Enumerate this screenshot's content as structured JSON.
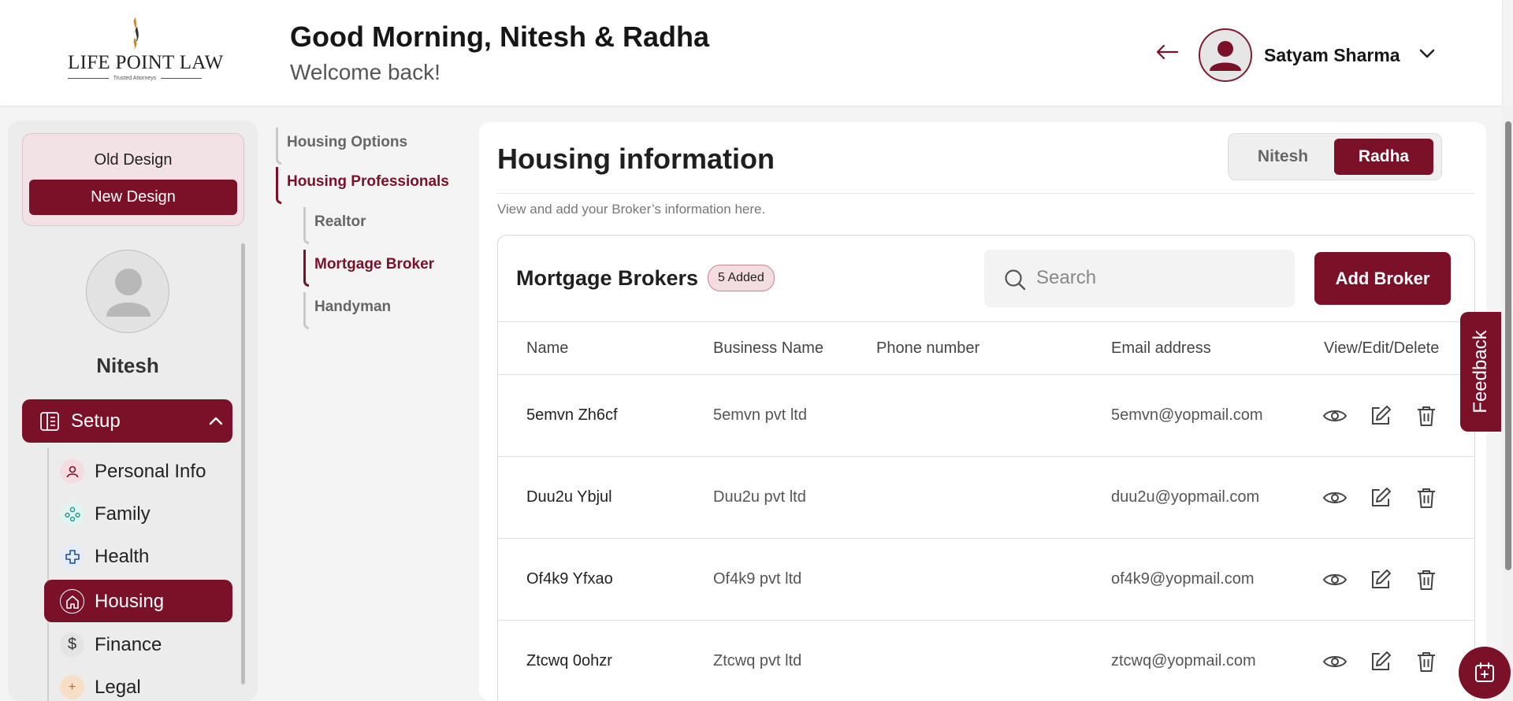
{
  "header": {
    "logo_text": "LIFE POINT LAW",
    "logo_tagline": "Trusted Attorneys",
    "greeting": "Good Morning, Nitesh & Radha",
    "welcome": "Welcome back!",
    "user_name": "Satyam Sharma"
  },
  "sidebar": {
    "old_design_label": "Old Design",
    "new_design_label": "New Design",
    "profile_name": "Nitesh",
    "setup_label": "Setup",
    "items": [
      {
        "label": "Personal Info",
        "icon": "person-icon"
      },
      {
        "label": "Family",
        "icon": "family-icon"
      },
      {
        "label": "Health",
        "icon": "health-cross-icon"
      },
      {
        "label": "Housing",
        "icon": "house-icon"
      },
      {
        "label": "Finance",
        "icon": "dollar-icon"
      },
      {
        "label": "Legal",
        "icon": "legal-icon"
      }
    ]
  },
  "subnav": {
    "housing_options": "Housing Options",
    "housing_professionals": "Housing Professionals",
    "realtor": "Realtor",
    "mortgage_broker": "Mortgage Broker",
    "handyman": "Handyman"
  },
  "main": {
    "title": "Housing information",
    "description": "View and add your Broker’s information here.",
    "toggle": {
      "option_a": "Nitesh",
      "option_b": "Radha",
      "selected": "Radha"
    }
  },
  "card": {
    "title": "Mortgage Brokers",
    "count_badge": "5 Added",
    "search_placeholder": "Search",
    "add_button": "Add Broker",
    "columns": [
      "Name",
      "Business Name",
      "Phone number",
      "Email address",
      "View/Edit/Delete"
    ],
    "rows": [
      {
        "name": "5emvn Zh6cf",
        "business": "5emvn pvt ltd",
        "phone": "",
        "email": "5emvn@yopmail.com"
      },
      {
        "name": "Duu2u Ybjul",
        "business": "Duu2u pvt ltd",
        "phone": "",
        "email": "duu2u@yopmail.com"
      },
      {
        "name": "Of4k9 Yfxao",
        "business": "Of4k9 pvt ltd",
        "phone": "",
        "email": "of4k9@yopmail.com"
      },
      {
        "name": "Ztcwq 0ohzr",
        "business": "Ztcwq pvt ltd",
        "phone": "",
        "email": "ztcwq@yopmail.com"
      }
    ]
  },
  "feedback_label": "Feedback",
  "colors": {
    "brand": "#7a1129",
    "badge_bg": "#f3dde1"
  }
}
